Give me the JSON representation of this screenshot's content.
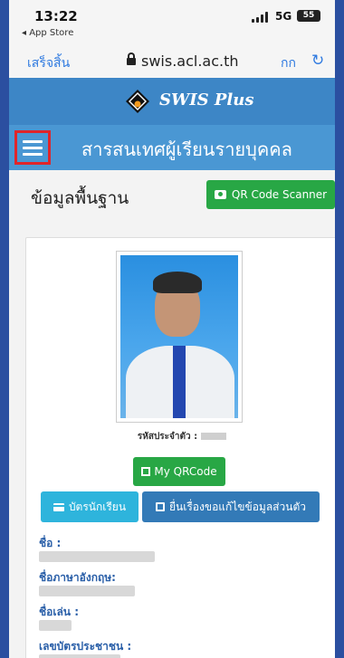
{
  "status_bar": {
    "time": "13:22",
    "back_app": "◂ App Store",
    "network": "5G",
    "battery": "55"
  },
  "browser": {
    "done_label": "เสร็จสิ้น",
    "url": "swis.acl.ac.th",
    "text_size": "กก",
    "reload_icon": "reload-icon"
  },
  "brand": {
    "name": "SWIS Plus",
    "logo_icon": "swis-logo-icon"
  },
  "header": {
    "title": "สารสนเทศผู้เรียนรายบุคคล",
    "menu_icon": "hamburger-menu-icon"
  },
  "section": {
    "title": "ข้อมูลพื้นฐาน",
    "qr_scanner_label": "QR Code Scanner"
  },
  "profile": {
    "student_id_label": "รหัสประจำตัว :",
    "my_qrcode_label": "My QRCode",
    "student_card_label": "บัตรนักเรียน",
    "edit_request_label": "ยื่นเรื่องขอแก้ไขข้อมูลส่วนตัว",
    "fields": [
      {
        "label": "ชื่อ :"
      },
      {
        "label": "ชื่อภาษาอังกฤษ:"
      },
      {
        "label": "ชื่อเล่น :"
      },
      {
        "label": "เลขบัตรประชาชน :"
      }
    ]
  },
  "colors": {
    "brand_bar": "#3d86c6",
    "title_bar": "#4a97d3",
    "success": "#28a745",
    "info": "#2eb4dc",
    "primary": "#337ab7",
    "highlight": "#e0252a"
  }
}
